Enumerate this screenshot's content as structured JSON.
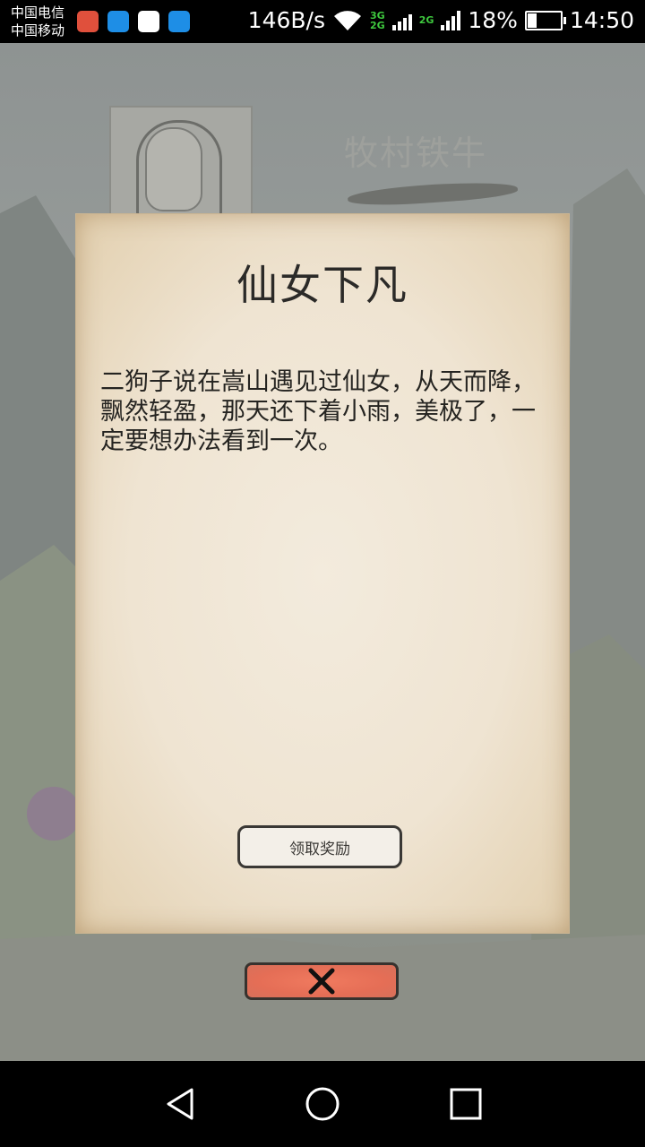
{
  "status_bar": {
    "carrier_1": "中国电信",
    "carrier_2": "中国移动",
    "net_speed": "146B/s",
    "network_type_top": "3G",
    "network_type_bottom": "2G",
    "network_type_2": "2G",
    "battery": "18%",
    "time": "14:50",
    "notification_colors": [
      "#e0503c",
      "#1e8ee6",
      "#ffffff",
      "#1e8ee6"
    ]
  },
  "background": {
    "npc_name": "牧村铁牛"
  },
  "dialog": {
    "title": "仙女下凡",
    "body": "二狗子说在嵩山遇见过仙女，从天而降，飘然轻盈，那天还下着小雨，美极了，一定要想办法看到一次。",
    "claim_button": "领取奖励"
  },
  "colors": {
    "close_button": "#e8705a",
    "paper": "#efe4d2"
  }
}
